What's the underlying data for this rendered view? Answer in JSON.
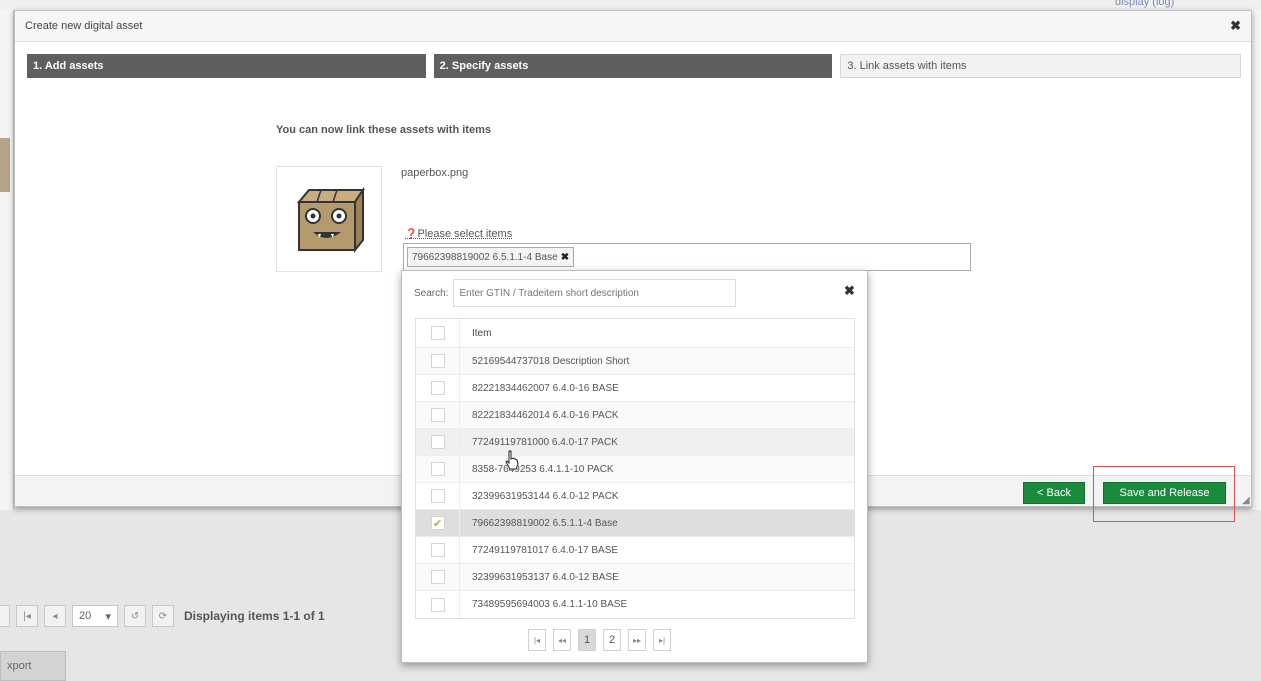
{
  "background": {
    "link_text": "display (log)",
    "pager": {
      "page_size": "20",
      "status_text": "Displaying items 1-1 of 1"
    },
    "export_label": "xport"
  },
  "modal": {
    "title": "Create new digital asset",
    "steps": [
      {
        "label": "1. Add assets"
      },
      {
        "label": "2. Specify assets"
      },
      {
        "label": "3. Link assets with items"
      }
    ],
    "intro": "You can now link these assets with items",
    "asset": {
      "filename": "paperbox.png",
      "thumbnail_icon": "paperbox-monster-icon"
    },
    "select_label": "Please select items",
    "selected_tags": [
      {
        "label": "79662398819002 6.5.1.1-4 Base"
      }
    ],
    "buttons": {
      "back": "< Back",
      "save_release": "Save and Release"
    }
  },
  "dropdown": {
    "search_label": "Search:",
    "search_placeholder": "Enter GTIN / Tradeitem short description",
    "column_header": "Item",
    "rows": [
      {
        "label": "52169544737018 Description Short",
        "checked": false
      },
      {
        "label": "82221834462007 6.4.0-16 BASE",
        "checked": false
      },
      {
        "label": "82221834462014 6.4.0-16 PACK",
        "checked": false
      },
      {
        "label": "77249119781000 6.4.0-17 PACK",
        "checked": false
      },
      {
        "label": "8358-7649253 6.4.1.1-10 PACK",
        "checked": false
      },
      {
        "label": "32399631953144 6.4.0-12 PACK",
        "checked": false
      },
      {
        "label": "79662398819002 6.5.1.1-4 Base",
        "checked": true
      },
      {
        "label": "77249119781017 6.4.0-17 BASE",
        "checked": false
      },
      {
        "label": "32399631953137 6.4.0-12 BASE",
        "checked": false
      },
      {
        "label": "73489595694003 6.4.1.1-10 BASE",
        "checked": false
      }
    ],
    "pager": {
      "pages": [
        "1",
        "2"
      ],
      "current": "1"
    }
  }
}
